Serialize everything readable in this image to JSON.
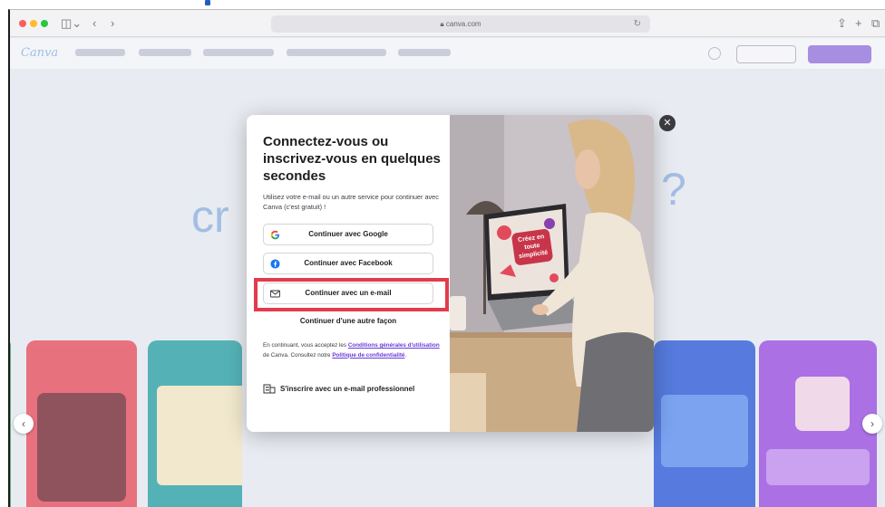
{
  "browser": {
    "url": "canva.com"
  },
  "canva": {
    "logo": "Canva"
  },
  "modal": {
    "title": "Connectez-vous ou inscrivez-vous en quelques secondes",
    "description": "Utilisez votre e-mail ou un autre service pour continuer avec Canva (c'est gratuit) !",
    "buttons": {
      "google": "Continuer avec Google",
      "facebook": "Continuer avec Facebook",
      "email": "Continuer avec un e-mail"
    },
    "other_way": "Continuer d'une autre façon",
    "terms": {
      "prefix": "En continuant, vous acceptez les ",
      "conditions_link": "Conditions générales d'utilisation",
      "middle": " de Canva. Consultez notre ",
      "privacy_link": "Politique de confidentialité",
      "suffix": "."
    },
    "pro_signup": "S'inscrire avec un e-mail professionnel",
    "illustration_text": "Créez en toute simplicité",
    "close_icon": "close-icon"
  },
  "highlight_color": "#e23b4e",
  "accent_color": "#6a3bd6"
}
